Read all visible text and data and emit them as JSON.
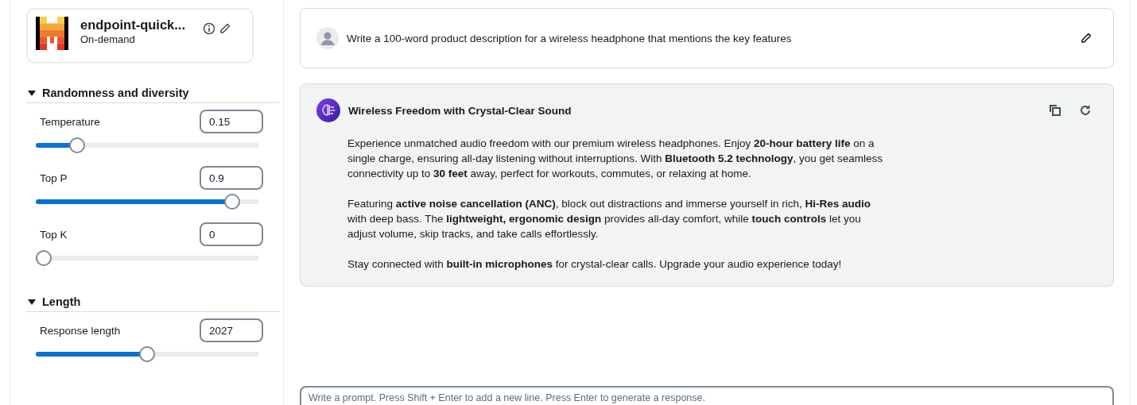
{
  "model": {
    "name": "endpoint-quick...",
    "mode": "On-demand"
  },
  "sections": [
    {
      "title": "Randomness and diversity",
      "expanded": true,
      "params": [
        {
          "label": "Temperature",
          "value": "0.15",
          "level": 0.16
        },
        {
          "label": "Top P",
          "value": "0.9",
          "level": 0.91
        },
        {
          "label": "Top K",
          "value": "0",
          "level": 0
        }
      ]
    },
    {
      "title": "Length",
      "expanded": true,
      "params": [
        {
          "label": "Response length",
          "value": "2027",
          "level": 0.5
        }
      ]
    }
  ],
  "messages": [
    {
      "kind": "user",
      "text": "Write a 100-word product description for a wireless headphone that mentions the key features"
    },
    {
      "kind": "assistant",
      "title": "Wireless Freedom with Crystal-Clear Sound",
      "paragraphs": [
        "Experience unmatched audio freedom with our premium wireless headphones. Enjoy **20-hour battery life** on a single charge, ensuring all-day listening without interruptions. With **Bluetooth 5.2 technology**, you get seamless connectivity up to **30 feet** away, perfect for workouts, commutes, or relaxing at home.",
        "Featuring **active noise cancellation (ANC)**, block out distractions and immerse yourself in rich, **Hi-Res audio** with deep bass. The **lightweight, ergonomic design** provides all-day comfort, while **touch controls** let you adjust volume, skip tracks, and take calls effortlessly.",
        "Stay connected with **built-in microphones** for crystal-clear calls. Upgrade your audio experience today!"
      ]
    }
  ],
  "prompt": {
    "placeholder": "Write a prompt. Press Shift + Enter to add a new line. Press Enter to generate a response."
  }
}
